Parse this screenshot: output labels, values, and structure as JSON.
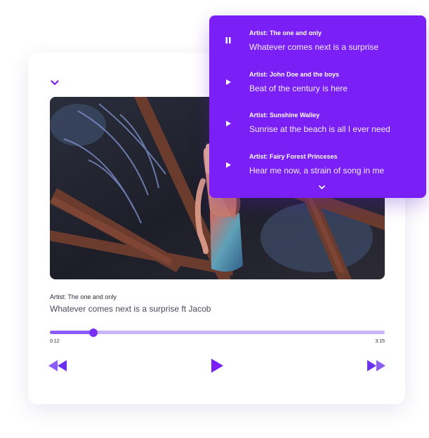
{
  "player": {
    "artist": "Artist: The one and only",
    "title": "Whatever comes next is a surprise ft Jacob",
    "current_time": "0:12",
    "duration": "3:15",
    "progress_fraction": 0.13,
    "accent_color": "#7a1ff6",
    "icons": {
      "collapse": "chevron-down-icon",
      "previous": "rewind-icon",
      "play": "play-icon",
      "next": "fast-forward-icon"
    }
  },
  "playlist": {
    "items": [
      {
        "artist": "Artist: The one and only",
        "title": "Whatever comes next is a surprise",
        "state": "playing",
        "icon": "pause-icon"
      },
      {
        "artist": "Artist: John Doe and the boys",
        "title": "Beat of the century is here",
        "state": "paused",
        "icon": "play-icon"
      },
      {
        "artist": "Artist: Sunshine Walley",
        "title": "Sunrise at the beach is all I ever need",
        "state": "paused",
        "icon": "play-icon"
      },
      {
        "artist": "Artist: Fairy Forest Princeses",
        "title": "Hear me now, a strain of song in me",
        "state": "paused",
        "icon": "play-icon"
      }
    ],
    "more_icon": "chevron-down-icon"
  }
}
